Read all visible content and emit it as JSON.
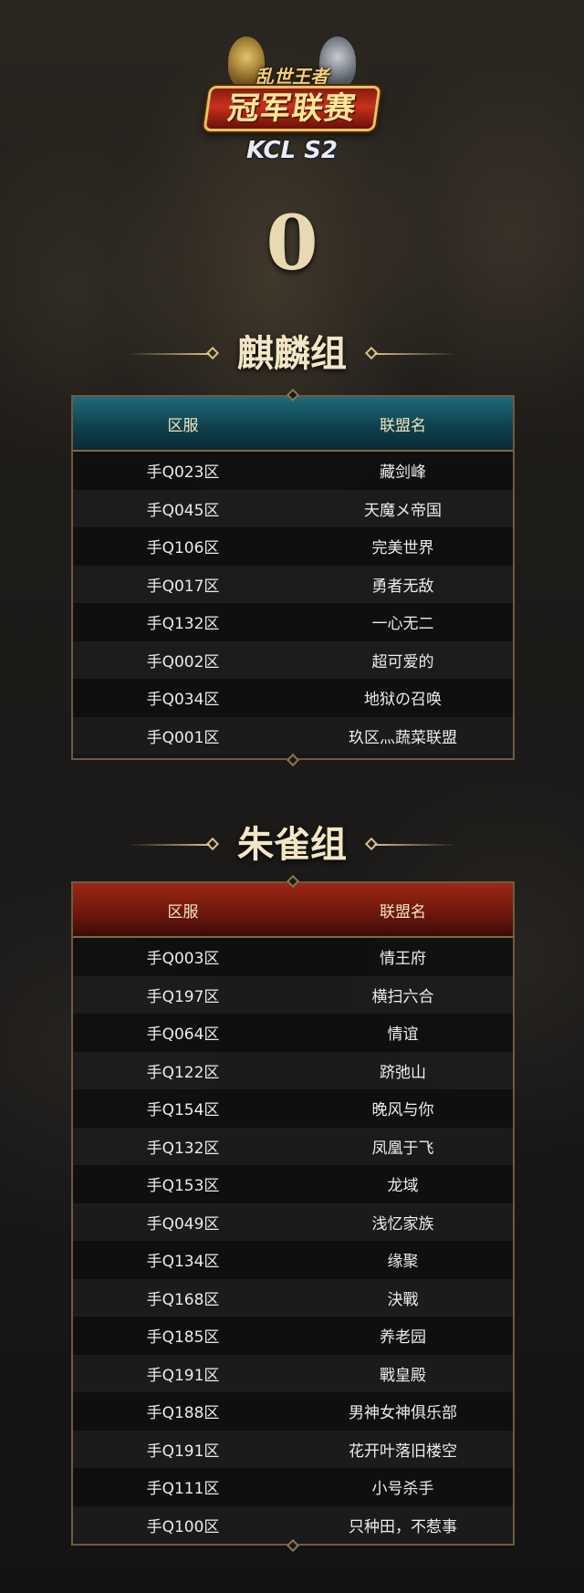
{
  "logo": {
    "top_text": "乱世王者",
    "main_text": "冠军联赛",
    "sub_text": "KCL S2"
  },
  "group_number": "0",
  "groups": [
    {
      "title": "麒麟组",
      "header_color": "#0f3e4b",
      "columns": [
        "区服",
        "联盟名"
      ],
      "rows": [
        [
          "手Q023区",
          "藏剑峰"
        ],
        [
          "手Q045区",
          "天魔メ帝国"
        ],
        [
          "手Q106区",
          "完美世界"
        ],
        [
          "手Q017区",
          "勇者无敌"
        ],
        [
          "手Q132区",
          "一心无二"
        ],
        [
          "手Q002区",
          "超可爱的"
        ],
        [
          "手Q034区",
          "地狱の召唤"
        ],
        [
          "手Q001区",
          "玖区灬蔬菜联盟"
        ]
      ]
    },
    {
      "title": "朱雀组",
      "header_color": "#6a170c",
      "columns": [
        "区服",
        "联盟名"
      ],
      "rows": [
        [
          "手Q003区",
          "情王府"
        ],
        [
          "手Q197区",
          "横扫六合"
        ],
        [
          "手Q064区",
          "情谊"
        ],
        [
          "手Q122区",
          "跻弛山"
        ],
        [
          "手Q154区",
          "晚风与你"
        ],
        [
          "手Q132区",
          "凤凰于飞"
        ],
        [
          "手Q153区",
          "龙域"
        ],
        [
          "手Q049区",
          "浅忆家族"
        ],
        [
          "手Q134区",
          "缘聚"
        ],
        [
          "手Q168区",
          "決戰"
        ],
        [
          "手Q185区",
          "养老园"
        ],
        [
          "手Q191区",
          "戰皇殿"
        ],
        [
          "手Q188区",
          "男神女神俱乐部"
        ],
        [
          "手Q191区",
          "花开叶落旧楼空"
        ],
        [
          "手Q111区",
          "小号杀手"
        ],
        [
          "手Q100区",
          "只种田，不惹事"
        ]
      ]
    }
  ]
}
